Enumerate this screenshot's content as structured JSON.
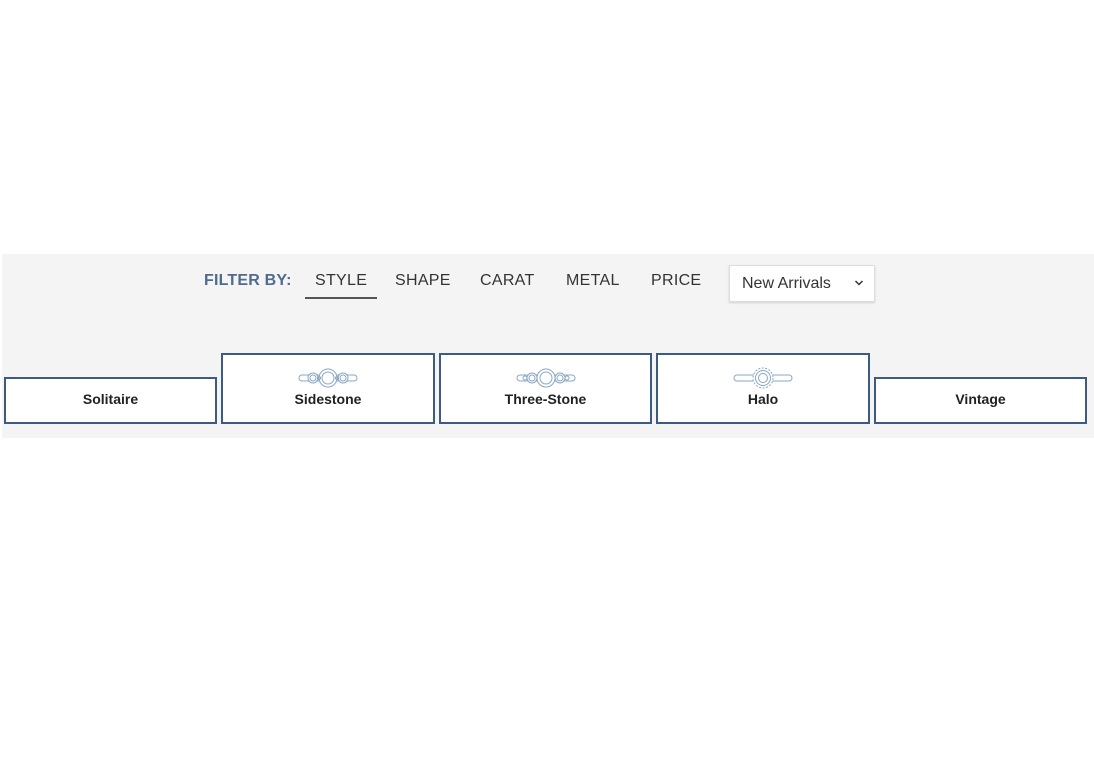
{
  "filter": {
    "label": "FILTER BY:",
    "tabs": [
      {
        "label": "STYLE",
        "active": true
      },
      {
        "label": "SHAPE",
        "active": false
      },
      {
        "label": "CARAT",
        "active": false
      },
      {
        "label": "METAL",
        "active": false
      },
      {
        "label": "PRICE",
        "active": false
      }
    ],
    "sort": {
      "selected": "New Arrivals",
      "icon": "chevron-down-icon"
    }
  },
  "styles": [
    {
      "label": "Solitaire",
      "icon": null
    },
    {
      "label": "Sidestone",
      "icon": "sidestone-ring-icon"
    },
    {
      "label": "Three-Stone",
      "icon": "three-stone-ring-icon"
    },
    {
      "label": "Halo",
      "icon": "halo-ring-icon"
    },
    {
      "label": "Vintage",
      "icon": null
    }
  ],
  "colors": {
    "accent": "#3d5a80",
    "filter_label": "#4f6b8d",
    "panel_bg": "#f4f4f4",
    "icon_stroke": "#8aa7c4"
  }
}
